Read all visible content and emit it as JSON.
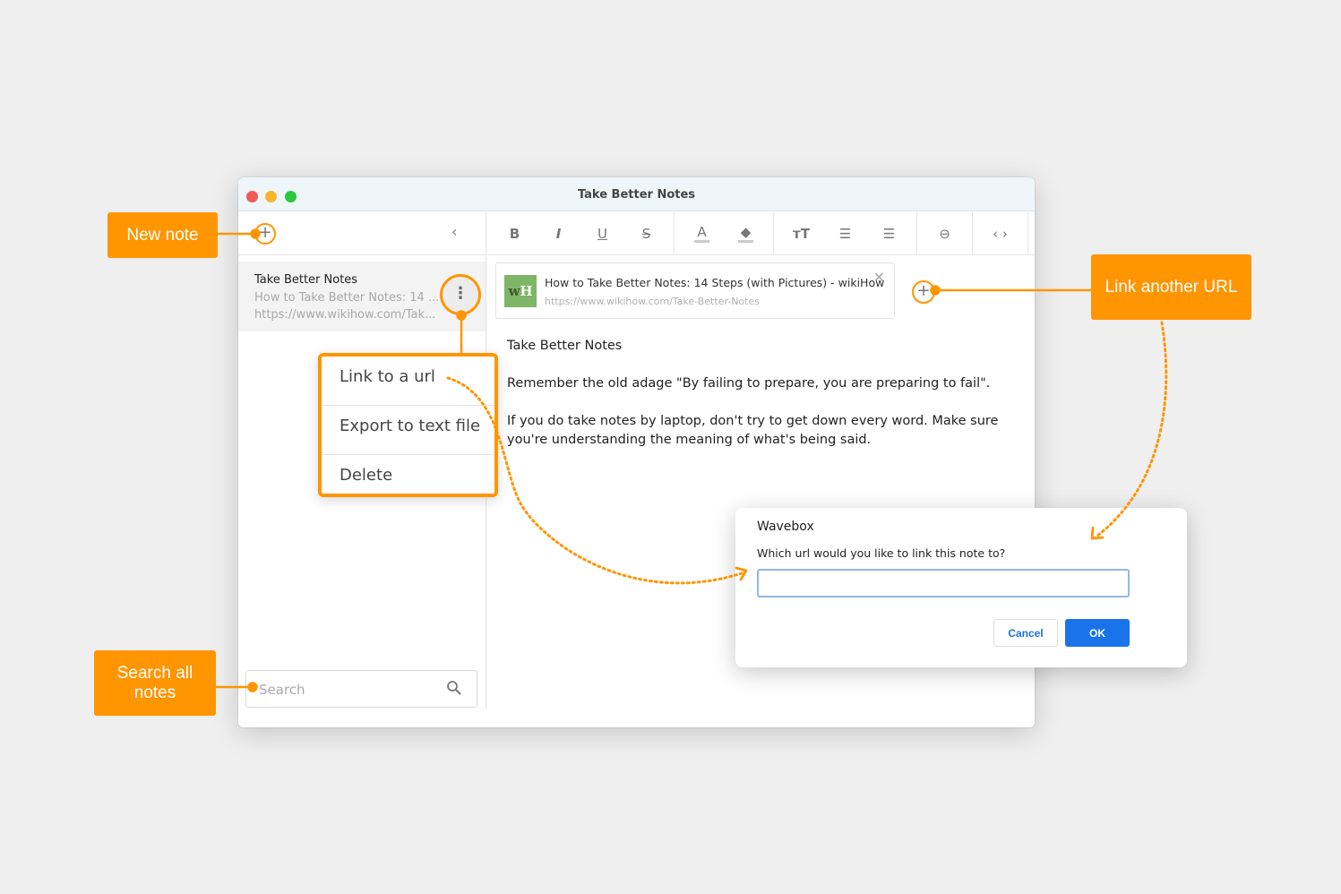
{
  "window": {
    "title": "Take Better Notes"
  },
  "sidebar": {
    "new_note_icon": "+",
    "collapse_icon": "‹",
    "notes": [
      {
        "title": "Take Better Notes",
        "subtitle": "How to Take Better Notes: 14 ...",
        "url": "https://www.wikihow.com/Tak...",
        "menu_icon": "⋮"
      }
    ],
    "search": {
      "placeholder": "Search"
    }
  },
  "toolbar": {
    "groups": [
      [
        {
          "name": "bold",
          "glyph": "B"
        },
        {
          "name": "italic",
          "glyph": "I"
        },
        {
          "name": "underline",
          "glyph": "U"
        },
        {
          "name": "strikethrough",
          "glyph": "S"
        }
      ],
      [
        {
          "name": "text-color",
          "glyph": "A"
        },
        {
          "name": "highlight",
          "glyph": "◆"
        }
      ],
      [
        {
          "name": "font-size",
          "glyph": "тT"
        },
        {
          "name": "numbered-list",
          "glyph": "☰"
        },
        {
          "name": "bullet-list",
          "glyph": "☰"
        }
      ],
      [
        {
          "name": "link",
          "glyph": "⊖"
        }
      ],
      [
        {
          "name": "code",
          "glyph": "‹ ›"
        }
      ],
      [
        {
          "name": "more",
          "glyph": "⌄"
        }
      ]
    ]
  },
  "linked_url": {
    "logo_w": "w",
    "logo_h": "H",
    "title": "How to Take Better Notes: 14 Steps (with Pictures) - wikiHow",
    "url": "https://www.wikihow.com/Take-Better-Notes",
    "close_icon": "✕"
  },
  "add_link_icon": "+",
  "note": {
    "paragraphs": [
      "Take Better Notes",
      "Remember the old adage \"By failing to prepare, you are preparing to fail\".",
      "If you do take notes by laptop, don't try to get down every word. Make sure you're understanding the meaning of what's being said."
    ]
  },
  "context_menu": {
    "items": [
      "Link to a url",
      "Export to text file",
      "Delete"
    ]
  },
  "dialog": {
    "title": "Wavebox",
    "message": "Which url would you like to link this note to?",
    "input_value": "",
    "cancel_label": "Cancel",
    "ok_label": "OK"
  },
  "callouts": {
    "new_note": "New note",
    "link_another": "Link another URL",
    "search_all": "Search all notes"
  },
  "colors": {
    "accent": "#ff9500",
    "primary_button": "#1a73e8"
  }
}
